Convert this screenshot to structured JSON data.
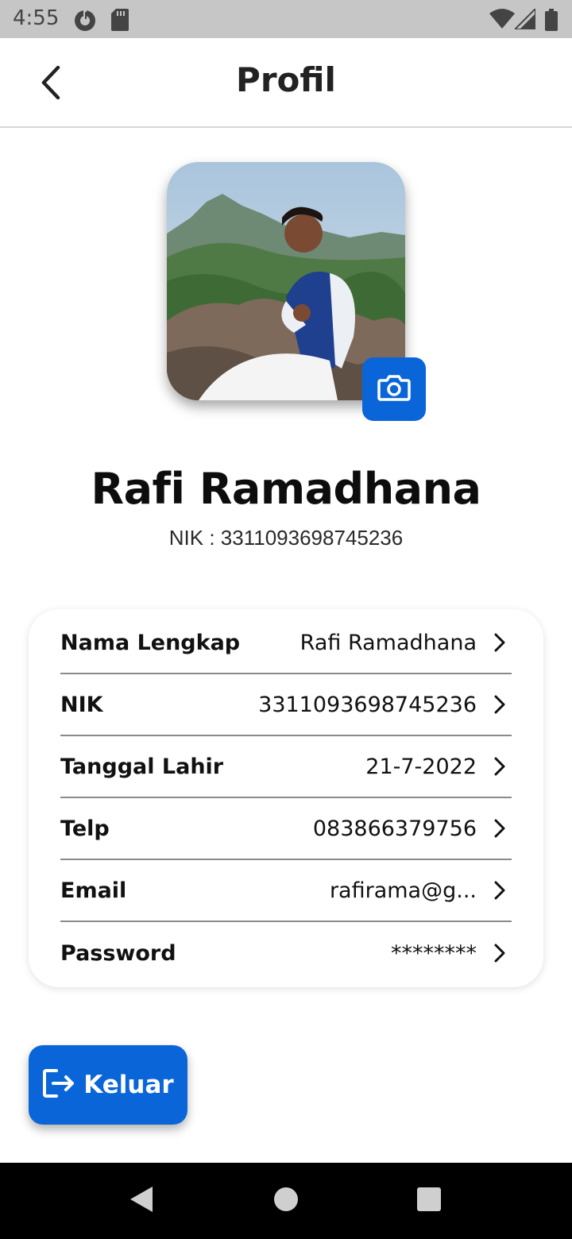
{
  "status_bar": {
    "time": "4:55",
    "icons": [
      "data-saver-icon",
      "sd-card-icon",
      "wifi-icon",
      "signal-icon",
      "battery-icon"
    ]
  },
  "app_bar": {
    "title": "Profil",
    "back_icon": "chevron-left-icon"
  },
  "profile": {
    "avatar_alt": "profile-photo",
    "camera_icon": "camera-icon",
    "name": "Rafi Ramadhana",
    "nik_line": "NIK : 3311093698745236"
  },
  "details": [
    {
      "label": "Nama Lengkap",
      "value": "Rafi Ramadhana"
    },
    {
      "label": "NIK",
      "value": "3311093698745236"
    },
    {
      "label": "Tanggal Lahir",
      "value": "21-7-2022"
    },
    {
      "label": "Telp",
      "value": "083866379756"
    },
    {
      "label": "Email",
      "value": "rafirama@g..."
    },
    {
      "label": "Password",
      "value": "********"
    }
  ],
  "logout": {
    "label": "Keluar",
    "icon": "logout-icon"
  },
  "colors": {
    "accent": "#0a66d8",
    "status_bar_bg": "#c6c6c6",
    "nav_bar_bg": "#000000"
  },
  "nav_bar": {
    "icons": [
      "back-triangle-icon",
      "home-circle-icon",
      "recents-square-icon"
    ]
  }
}
